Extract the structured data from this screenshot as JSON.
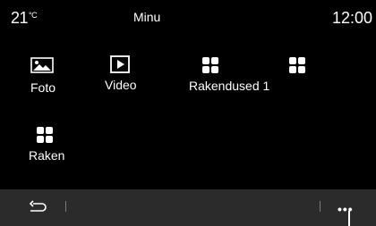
{
  "status": {
    "temperature": "21",
    "temperature_unit": "°C",
    "title": "Minu",
    "time": "12:00"
  },
  "apps": [
    {
      "label": "Foto",
      "icon": "photo-icon"
    },
    {
      "label": "Video",
      "icon": "video-icon"
    },
    {
      "label": "Rakendused 1",
      "icon": "apps-grid-icon"
    },
    {
      "label": "",
      "icon": "apps-grid-icon"
    },
    {
      "label": "Raken",
      "icon": "apps-grid-icon"
    }
  ],
  "bottom_bar": {
    "back_icon": "back-arrow-icon",
    "more_label": "•••",
    "more_icon": "more-icon"
  },
  "colors": {
    "background": "#000000",
    "bottom_bar": "#2b2b2b",
    "text": "#ffffff"
  }
}
